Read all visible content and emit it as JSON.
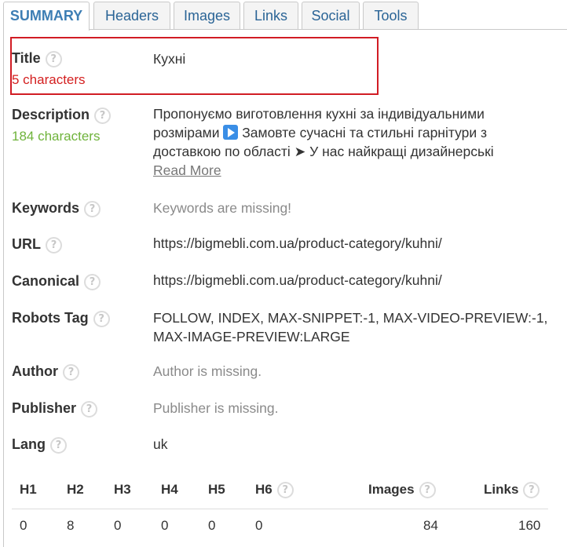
{
  "tabs": [
    "SUMMARY",
    "Headers",
    "Images",
    "Links",
    "Social",
    "Tools"
  ],
  "help_glyph": "?",
  "title": {
    "label": "Title",
    "status": "5 characters",
    "value": "Кухні"
  },
  "description": {
    "label": "Description",
    "status": "184 characters",
    "line1": "Пропонуємо виготовлення кухні за індивідуальними",
    "line2_pre": "розмірами",
    "line2_post": "Замовте сучасні та стильні гарнітури з",
    "line3": "доставкою по області ➤ У нас найкращі дизайнерські",
    "read_more": "Read More"
  },
  "keywords": {
    "label": "Keywords",
    "value": "Keywords are missing!"
  },
  "url": {
    "label": "URL",
    "value": "https://bigmebli.com.ua/product-category/kuhni/"
  },
  "canonical": {
    "label": "Canonical",
    "value": "https://bigmebli.com.ua/product-category/kuhni/"
  },
  "robots": {
    "label": "Robots Tag",
    "line1": "FOLLOW, INDEX, MAX-SNIPPET:-1, MAX-VIDEO-PREVIEW:-1,",
    "line2": "MAX-IMAGE-PREVIEW:LARGE"
  },
  "author": {
    "label": "Author",
    "value": "Author is missing."
  },
  "publisher": {
    "label": "Publisher",
    "value": "Publisher is missing."
  },
  "lang": {
    "label": "Lang",
    "value": "uk"
  },
  "stats": {
    "headers": [
      "H1",
      "H2",
      "H3",
      "H4",
      "H5",
      "H6",
      "Images",
      "Links"
    ],
    "values": [
      "0",
      "8",
      "0",
      "0",
      "0",
      "0",
      "84",
      "160"
    ]
  },
  "colors": {
    "accent": "#3d7eb4",
    "error": "#d42020",
    "ok": "#6fb33b",
    "highlight_box": "#d11c24"
  }
}
